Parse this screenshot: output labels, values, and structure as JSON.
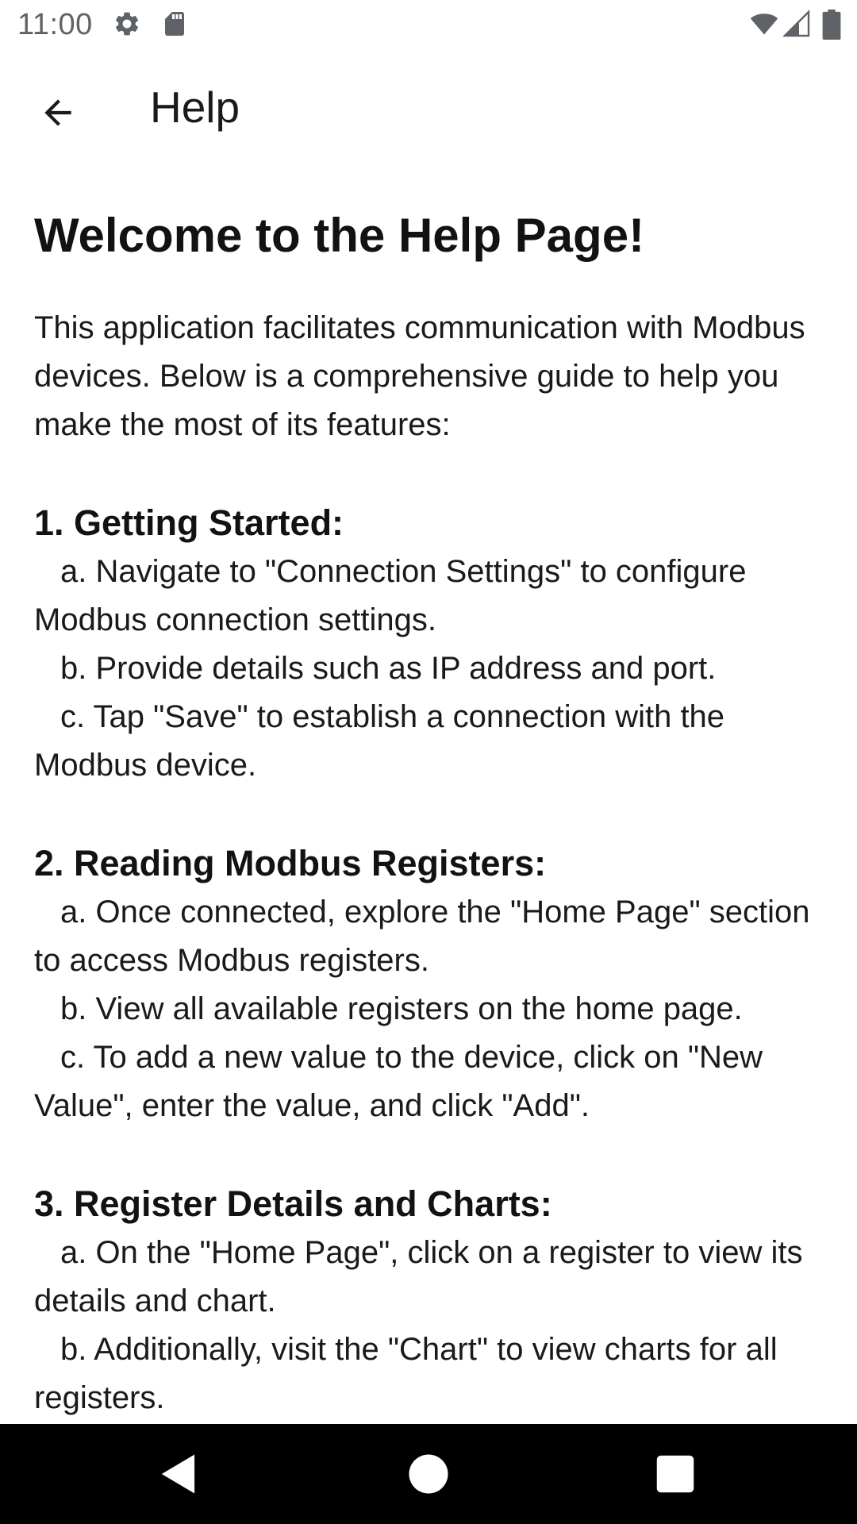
{
  "status_bar": {
    "time": "11:00",
    "icons": [
      "gear-icon",
      "sd-card-icon",
      "wifi-icon",
      "signal-icon",
      "battery-icon"
    ]
  },
  "app_bar": {
    "title": "Help",
    "back_icon": "arrow-back-icon"
  },
  "content": {
    "heading": "Welcome to the Help Page!",
    "intro": "This application facilitates communication with Modbus devices. Below is a comprehensive guide to help you make the most of its features:",
    "sections": [
      {
        "title": "1. Getting Started:",
        "items": [
          "a. Navigate to \"Connection Settings\" to configure Modbus connection settings.",
          "b. Provide details such as IP address and port.",
          "c. Tap \"Save\" to establish a connection with the Modbus device."
        ]
      },
      {
        "title": "2. Reading Modbus Registers:",
        "items": [
          "a. Once connected, explore the \"Home Page\" section to access Modbus registers.",
          "b. View all available registers on the home page.",
          "c. To add a new value to the device, click on \"New Value\", enter the value, and click \"Add\"."
        ]
      },
      {
        "title": "3. Register Details and Charts:",
        "items": [
          "a. On the \"Home Page\", click on a register to view its details and chart.",
          "b. Additionally, visit the \"Chart\" to view charts for all registers."
        ]
      }
    ]
  },
  "nav_bar": {
    "icons": [
      "nav-back-icon",
      "nav-home-icon",
      "nav-recents-icon"
    ]
  },
  "colors": {
    "status_text": "#5f6368",
    "text": "#1a1a1a",
    "nav_background": "#000000"
  }
}
